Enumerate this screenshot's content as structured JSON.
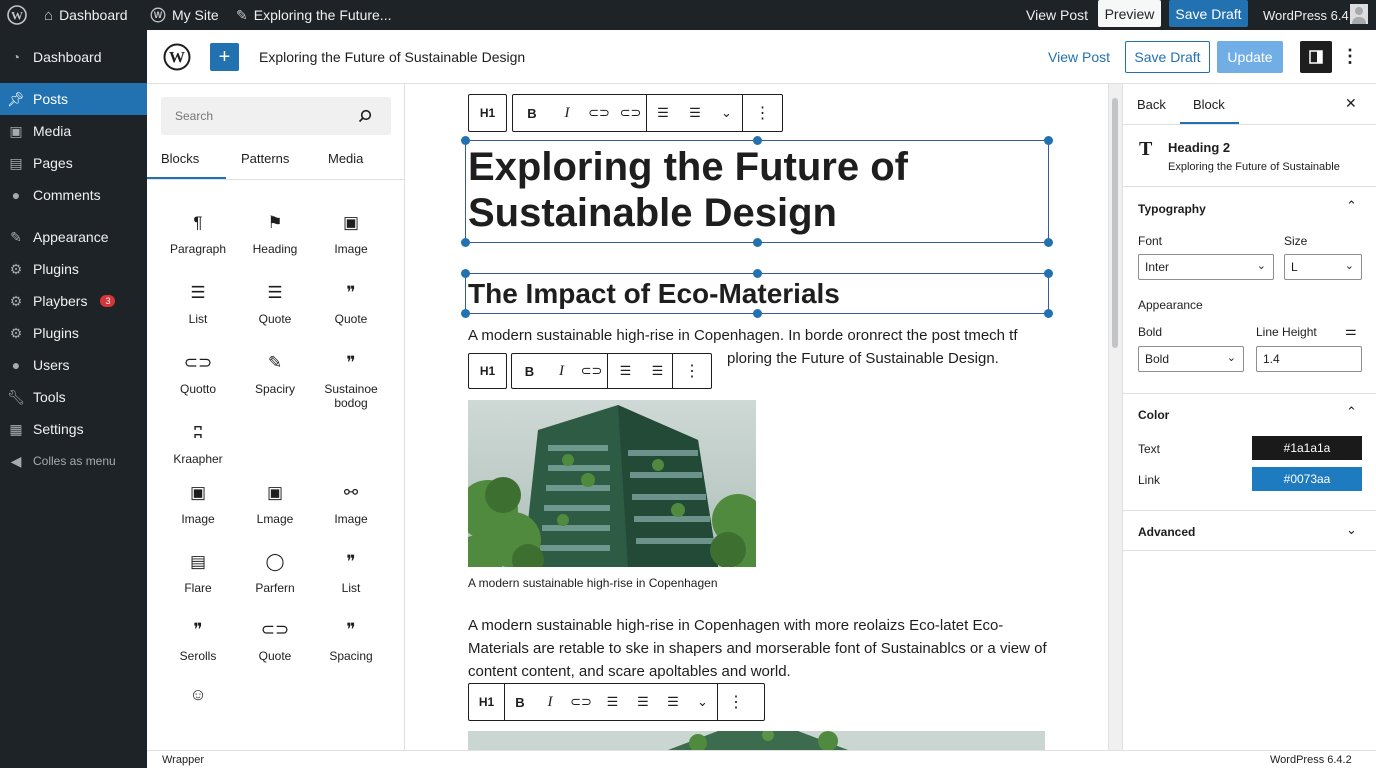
{
  "adminbar": {
    "dashboard": "Dashboard",
    "mysite": "My Site",
    "editing": "Exploring the Future...",
    "view_post": "View Post",
    "preview": "Preview",
    "save_draft": "Save Draft",
    "version": "WordPress 6.4.2"
  },
  "sidebar": {
    "items": [
      {
        "label": "Dashboard",
        "icon": "dashboard-icon"
      },
      {
        "label": "Posts",
        "icon": "pin-icon"
      },
      {
        "label": "Media",
        "icon": "media-icon"
      },
      {
        "label": "Pages",
        "icon": "pages-icon"
      },
      {
        "label": "Comments",
        "icon": "comments-icon"
      },
      {
        "label": "Appearance",
        "icon": "brush-icon"
      },
      {
        "label": "Plugins",
        "icon": "plugin-icon"
      },
      {
        "label": "Playbers",
        "icon": "plugin-icon",
        "badge": "3"
      },
      {
        "label": "Plugins",
        "icon": "plugin-icon"
      },
      {
        "label": "Users",
        "icon": "users-icon"
      },
      {
        "label": "Tools",
        "icon": "wrench-icon"
      },
      {
        "label": "Settings",
        "icon": "settings-icon"
      },
      {
        "label": "Colles as menu",
        "icon": "collapse-icon"
      }
    ]
  },
  "header": {
    "title": "Exploring the Future of Sustainable Design",
    "view_post": "View Post",
    "save_draft": "Save Draft",
    "update": "Update"
  },
  "inserter": {
    "search_placeholder": "Search",
    "tabs": [
      "Blocks",
      "Patterns",
      "Media"
    ],
    "blocks": [
      {
        "label": "Paragraph",
        "icon": "¶"
      },
      {
        "label": "Heading",
        "icon": "⚑"
      },
      {
        "label": "Image",
        "icon": "▣"
      },
      {
        "label": "List",
        "icon": "☰"
      },
      {
        "label": "Quote",
        "icon": "☰"
      },
      {
        "label": "Quote",
        "icon": "❞"
      },
      {
        "label": "Quotto",
        "icon": "⊂⊃"
      },
      {
        "label": "Spaciry",
        "icon": "✎"
      },
      {
        "label": "Sustainoe bodog",
        "icon": "❞"
      },
      {
        "label": "Kraapher",
        "icon": "ʭ"
      },
      {
        "label": "Image",
        "icon": "▣"
      },
      {
        "label": "Lmage",
        "icon": "▣"
      },
      {
        "label": "Image",
        "icon": "⚯"
      },
      {
        "label": "Flare",
        "icon": "▤"
      },
      {
        "label": "Parfern",
        "icon": "◯"
      },
      {
        "label": "List",
        "icon": "❞"
      },
      {
        "label": "Serolls",
        "icon": "❞"
      },
      {
        "label": "Quote",
        "icon": "⊂⊃"
      },
      {
        "label": "Spacing",
        "icon": "❞"
      },
      {
        "label": "",
        "icon": "☺"
      }
    ]
  },
  "canvas": {
    "title_line1": "Exploring the Future of",
    "title_line2": "Sustainable Design",
    "heading2": "The Impact of Eco-Materials",
    "para1_line1": "A modern sustainable high-rise in Copenhagen. In borde oronrect the post tmech tf",
    "para1_line2_visible": "ploring the Future of Sustainable Design.",
    "caption": "A modern sustainable high-rise in Copenhagen",
    "para2_line1": "A modern sustainable high-rise in Copenhagen with more reolaizs Eco-latet Eco-",
    "para2_line2": "Materials are retable to ske in shapers and morserable font of Sustainablcs or a view of",
    "para2_line3": "content content, and scare apoltables and world.",
    "toolbar_heading": "H1"
  },
  "settings": {
    "tabs": [
      "Back",
      "Block"
    ],
    "block_name": "Heading 2",
    "block_desc": "Exploring the Future of Sustainable",
    "typography": "Typography",
    "font_label": "Font",
    "font_value": "Inter",
    "size_label": "Size",
    "size_value": "L",
    "appearance_label": "Appearance",
    "bold_label": "Bold",
    "bold_value": "Bold",
    "line_height_label": "Line Height",
    "line_height_value": "1.4",
    "color": "Color",
    "text_label": "Text",
    "text_color": "#1a1a1a",
    "link_label": "Link",
    "link_color": "#0073aa",
    "advanced": "Advanced"
  },
  "footer": {
    "breadcrumb": "Wrapper",
    "version": "WordPress 6.4.2"
  },
  "colors": {
    "admin_dark": "#1d2327",
    "accent": "#2271b1",
    "link_swatch": "#1e7bc0",
    "text_swatch": "#1a1a1a"
  }
}
